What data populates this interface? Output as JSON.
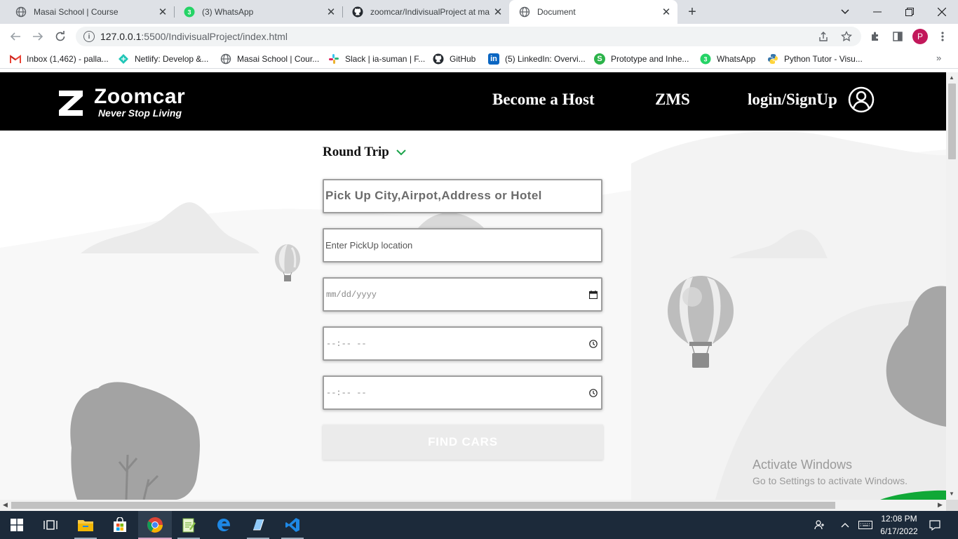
{
  "browser": {
    "tabs": [
      {
        "title": "Masai School | Course",
        "icon": "globe-icon"
      },
      {
        "title": "(3) WhatsApp",
        "icon": "whatsapp-icon",
        "badge": "3"
      },
      {
        "title": "zoomcar/IndivisualProject at ma",
        "icon": "github-icon"
      },
      {
        "title": "Document",
        "icon": "globe-icon",
        "active": true
      }
    ],
    "url_host": "127.0.0.1",
    "url_path": ":5500/IndivisualProject/index.html",
    "profile_initial": "P",
    "bookmarks": [
      {
        "label": "Inbox (1,462) - palla...",
        "icon": "gmail-icon"
      },
      {
        "label": "Netlify: Develop &...",
        "icon": "netlify-icon"
      },
      {
        "label": "Masai School | Cour...",
        "icon": "globe-icon"
      },
      {
        "label": "Slack | ia-suman | F...",
        "icon": "slack-icon"
      },
      {
        "label": "GitHub",
        "icon": "github-icon"
      },
      {
        "label": "(5) LinkedIn: Overvi...",
        "icon": "linkedin-icon"
      },
      {
        "label": "Prototype and Inhe...",
        "icon": "prototype-icon"
      },
      {
        "label": "WhatsApp",
        "icon": "whatsapp-icon",
        "badge": "3"
      },
      {
        "label": "Python Tutor - Visu...",
        "icon": "python-icon"
      }
    ]
  },
  "site": {
    "logo_brand": "Zoomcar",
    "logo_tagline": "Never Stop Living",
    "nav": {
      "host": "Become a Host",
      "zms": "ZMS",
      "login": "login/SignUp"
    },
    "trip_type": "Round Trip",
    "form": {
      "city_placeholder": "Pick Up City,Airpot,Address or Hotel",
      "location_placeholder": "Enter PickUp location",
      "date_placeholder": "mm/dd/yyyy",
      "time1_placeholder": "--:-- --",
      "time2_placeholder": "--:-- --",
      "submit_label": "FIND CARS"
    },
    "colors": {
      "header_bg": "#000000",
      "accent_green": "#1aa34a",
      "button_bg": "#ebebeb"
    }
  },
  "watermark": {
    "line1": "Activate Windows",
    "line2": "Go to Settings to activate Windows."
  },
  "taskbar": {
    "time": "12:08 PM",
    "date": "6/17/2022"
  }
}
